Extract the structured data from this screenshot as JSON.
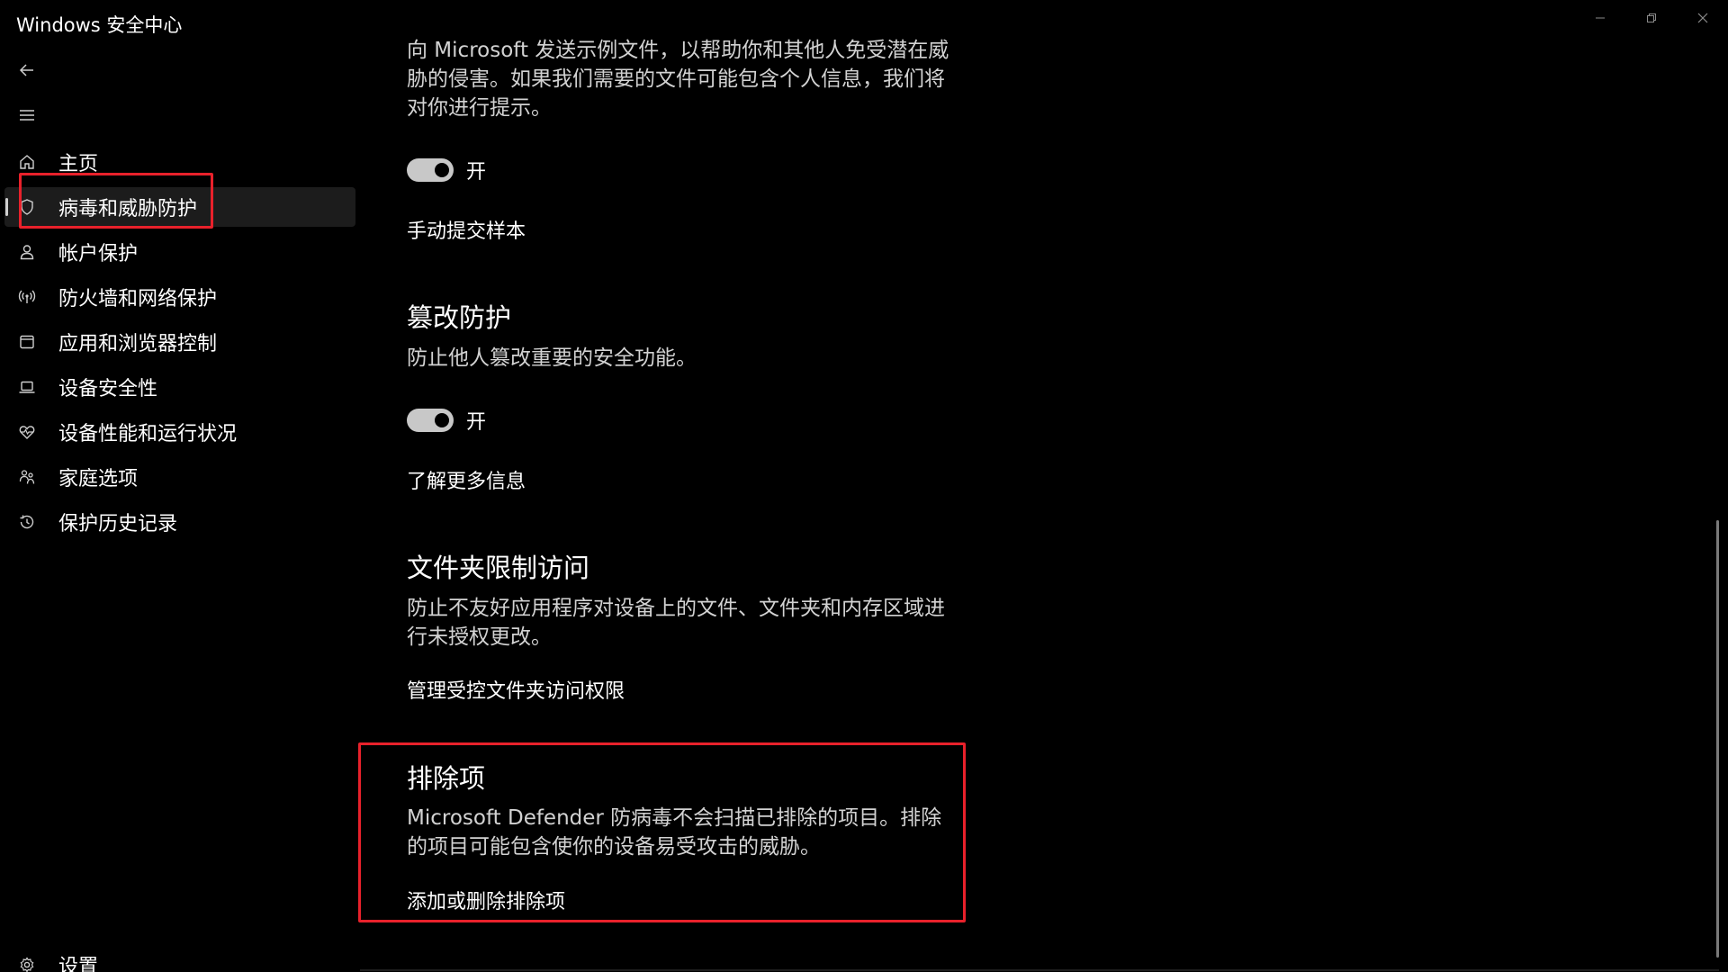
{
  "window": {
    "title": "Windows 安全中心"
  },
  "sidebar": {
    "items": [
      {
        "label": "主页",
        "icon": "home-icon"
      },
      {
        "label": "病毒和威胁防护",
        "icon": "shield-icon",
        "active": true
      },
      {
        "label": "帐户保护",
        "icon": "person-icon"
      },
      {
        "label": "防火墙和网络保护",
        "icon": "wifi-antenna-icon"
      },
      {
        "label": "应用和浏览器控制",
        "icon": "browser-window-icon"
      },
      {
        "label": "设备安全性",
        "icon": "laptop-icon"
      },
      {
        "label": "设备性能和运行状况",
        "icon": "heart-pulse-icon"
      },
      {
        "label": "家庭选项",
        "icon": "family-icon"
      },
      {
        "label": "保护历史记录",
        "icon": "history-icon"
      }
    ],
    "settings_label": "设置"
  },
  "main": {
    "sample_submission": {
      "desc": "向 Microsoft 发送示例文件，以帮助你和其他人免受潜在威胁的侵害。如果我们需要的文件可能包含个人信息，我们将对你进行提示。",
      "toggle_label": "开",
      "link": "手动提交样本"
    },
    "tamper": {
      "title": "篡改防护",
      "desc": "防止他人篡改重要的安全功能。",
      "toggle_label": "开",
      "link": "了解更多信息"
    },
    "folder_access": {
      "title": "文件夹限制访问",
      "desc": "防止不友好应用程序对设备上的文件、文件夹和内存区域进行未授权更改。",
      "link": "管理受控文件夹访问权限"
    },
    "exclusions": {
      "title": "排除项",
      "desc": "Microsoft Defender 防病毒不会扫描已排除的项目。排除的项目可能包含使你的设备易受攻击的威胁。",
      "link": "添加或删除排除项"
    }
  },
  "colors": {
    "highlight_box": "#e8212b",
    "toggle_on": "#c8c8c8",
    "background": "#000000"
  },
  "toggles": {
    "sample_submission": true,
    "tamper": true
  }
}
